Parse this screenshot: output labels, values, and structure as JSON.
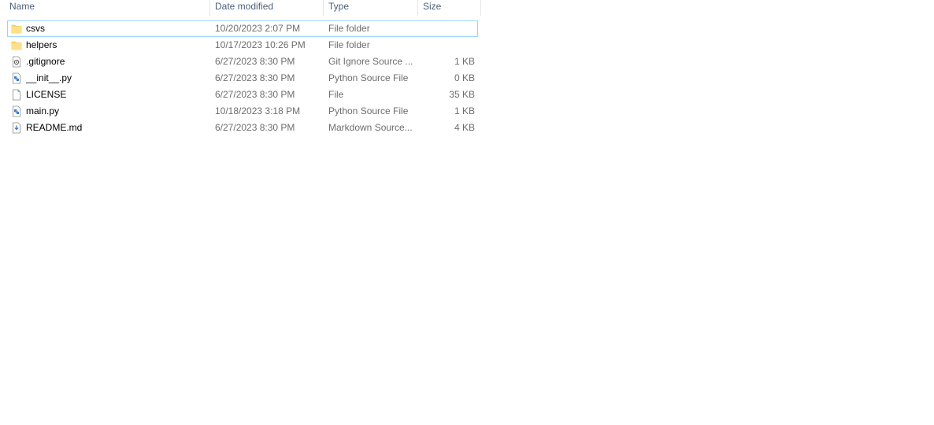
{
  "columns": {
    "name": "Name",
    "date_modified": "Date modified",
    "type": "Type",
    "size": "Size"
  },
  "files": [
    {
      "name": "csvs",
      "date": "10/20/2023 2:07 PM",
      "type": "File folder",
      "size": "",
      "icon": "folder-icon"
    },
    {
      "name": "helpers",
      "date": "10/17/2023 10:26 PM",
      "type": "File folder",
      "size": "",
      "icon": "folder-icon"
    },
    {
      "name": ".gitignore",
      "date": "6/27/2023 8:30 PM",
      "type": "Git Ignore Source ...",
      "size": "1 KB",
      "icon": "config-file-icon"
    },
    {
      "name": "__init__.py",
      "date": "6/27/2023 8:30 PM",
      "type": "Python Source File",
      "size": "0 KB",
      "icon": "python-file-icon"
    },
    {
      "name": "LICENSE",
      "date": "6/27/2023 8:30 PM",
      "type": "File",
      "size": "35 KB",
      "icon": "blank-file-icon"
    },
    {
      "name": "main.py",
      "date": "10/18/2023 3:18 PM",
      "type": "Python Source File",
      "size": "1 KB",
      "icon": "python-file-icon"
    },
    {
      "name": "README.md",
      "date": "6/27/2023 8:30 PM",
      "type": "Markdown Source...",
      "size": "4 KB",
      "icon": "markdown-file-icon"
    }
  ],
  "colors": {
    "header_text": "#4c607a",
    "secondary_text": "#6d6d6d",
    "focus_border": "#99d1ff",
    "folder": "#ffd766"
  }
}
